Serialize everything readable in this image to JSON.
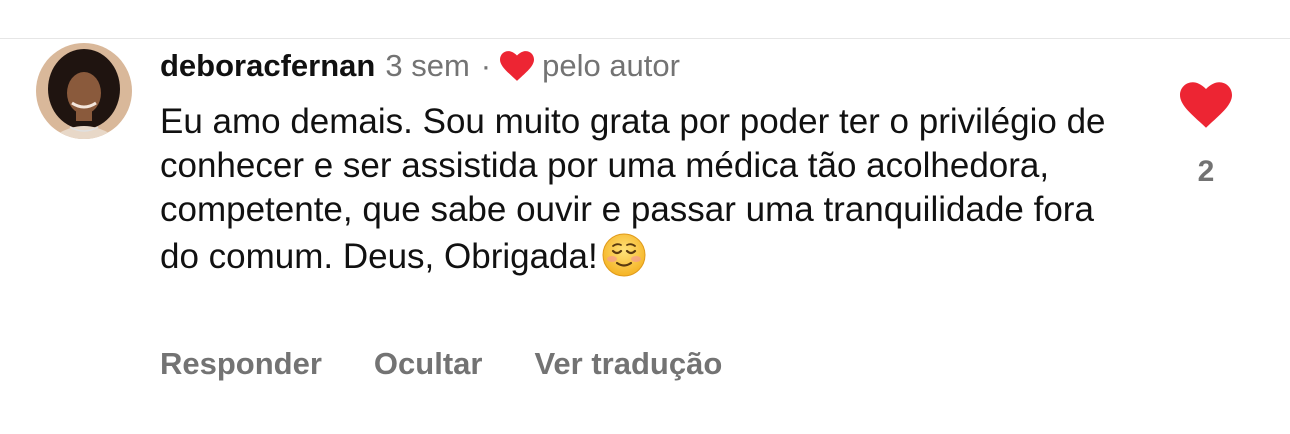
{
  "comment": {
    "username": "deboracfernan",
    "time_ago": "3 sem",
    "separator": "·",
    "author_like_label": "pelo autor",
    "text": "Eu amo demais. Sou muito grata por poder ter o privilégio de conhecer e ser assistida por uma médica tão acolhedora, competente, que sabe ouvir e passar uma tranquilidade fora do comum. Deus, Obrigada!",
    "emoji": "smiling-face-emoji",
    "like_count": "2",
    "liked": true
  },
  "actions": {
    "reply_label": "Responder",
    "hide_label": "Ocultar",
    "translate_label": "Ver tradução"
  },
  "colors": {
    "heart_red": "#ed2533",
    "secondary_text": "#737373",
    "primary_text": "#111111"
  },
  "icons": {
    "author_like": "heart-icon",
    "like": "heart-filled-icon",
    "avatar": "user-avatar"
  }
}
